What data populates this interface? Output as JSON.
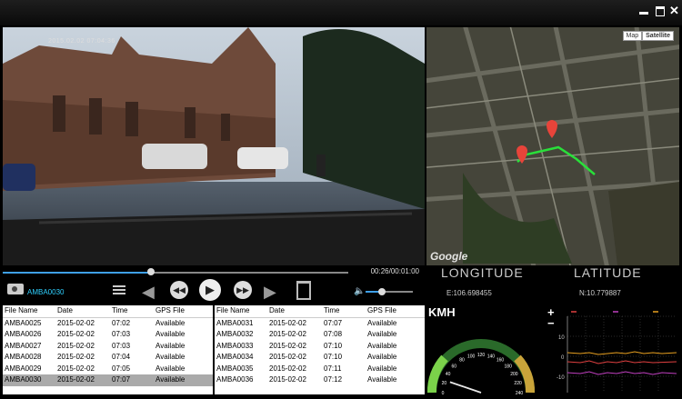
{
  "window": {
    "close_glyph": "✕"
  },
  "video": {
    "osd_text": "2015.02.02 07:04:36"
  },
  "map": {
    "tabs": [
      "Map",
      "Satellite"
    ],
    "attribution": "Google"
  },
  "player": {
    "timecode": "00:26/00:01:00",
    "progress_fraction": 0.43,
    "volume_fraction": 0.35,
    "current_file": "AMBA0030"
  },
  "gps": {
    "longitude_label": "LONGITUDE",
    "latitude_label": "LATITUDE",
    "longitude_value": "E:106.698455",
    "latitude_value": "N:10.779887"
  },
  "speed": {
    "unit_label": "KMH",
    "value_kmh": 25
  },
  "graph": {
    "plus": "+",
    "minus": "−",
    "y_ticks": [
      "10",
      "0",
      "-10"
    ]
  },
  "columns": [
    "File Name",
    "Date",
    "Time",
    "GPS File"
  ],
  "left_table": [
    [
      "AMBA0025",
      "2015-02-02",
      "07:02",
      "Available"
    ],
    [
      "AMBA0026",
      "2015-02-02",
      "07:03",
      "Available"
    ],
    [
      "AMBA0027",
      "2015-02-02",
      "07:03",
      "Available"
    ],
    [
      "AMBA0028",
      "2015-02-02",
      "07:04",
      "Available"
    ],
    [
      "AMBA0029",
      "2015-02-02",
      "07:05",
      "Available"
    ],
    [
      "AMBA0030",
      "2015-02-02",
      "07:07",
      "Available"
    ]
  ],
  "right_table": [
    [
      "AMBA0031",
      "2015-02-02",
      "07:07",
      "Available"
    ],
    [
      "AMBA0032",
      "2015-02-02",
      "07:08",
      "Available"
    ],
    [
      "AMBA0033",
      "2015-02-02",
      "07:10",
      "Available"
    ],
    [
      "AMBA0034",
      "2015-02-02",
      "07:10",
      "Available"
    ],
    [
      "AMBA0035",
      "2015-02-02",
      "07:11",
      "Available"
    ],
    [
      "AMBA0036",
      "2015-02-02",
      "07:12",
      "Available"
    ]
  ],
  "selected_row": "AMBA0030",
  "gauge_ticks": [
    "0",
    "20",
    "40",
    "60",
    "80",
    "100",
    "120",
    "140",
    "160",
    "180",
    "200",
    "220",
    "240"
  ]
}
